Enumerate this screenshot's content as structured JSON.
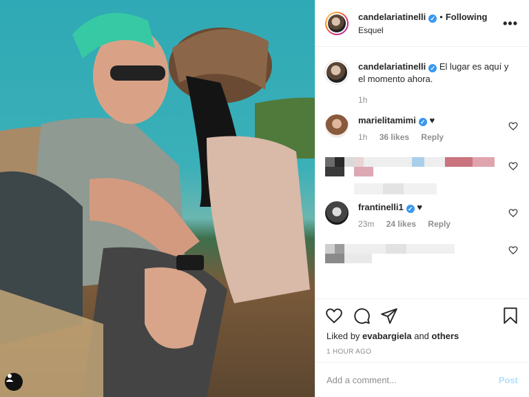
{
  "post": {
    "author": "candelariatinelli",
    "follow_state": "Following",
    "location": "Esquel",
    "more_label": "•••"
  },
  "caption": {
    "author": "candelariatinelli",
    "text": "El lugar es aquí y el momento ahora.",
    "time": "1h"
  },
  "comments": [
    {
      "author": "marielitamimi",
      "text": "♥",
      "time": "1h",
      "likes": "36 likes",
      "reply": "Reply",
      "verified": true
    },
    {
      "author": "frantinelli1",
      "text": "♥",
      "time": "23m",
      "likes": "24 likes",
      "reply": "Reply",
      "verified": true
    }
  ],
  "likes": {
    "prefix": "Liked by",
    "user": "evabargiela",
    "joiner": "and",
    "others": "others"
  },
  "timestamp": "1 HOUR AGO",
  "add_comment": {
    "placeholder": "Add a comment...",
    "post_label": "Post"
  },
  "icons": {
    "like": "heart-icon",
    "comment": "comment-icon",
    "share": "share-icon",
    "save": "bookmark-icon",
    "user_tag": "user-tag-icon",
    "verified": "verified-badge-icon"
  },
  "colors": {
    "link_blue": "#3897f0",
    "post_disabled": "#b2dffc",
    "muted": "#8e8e8e"
  }
}
